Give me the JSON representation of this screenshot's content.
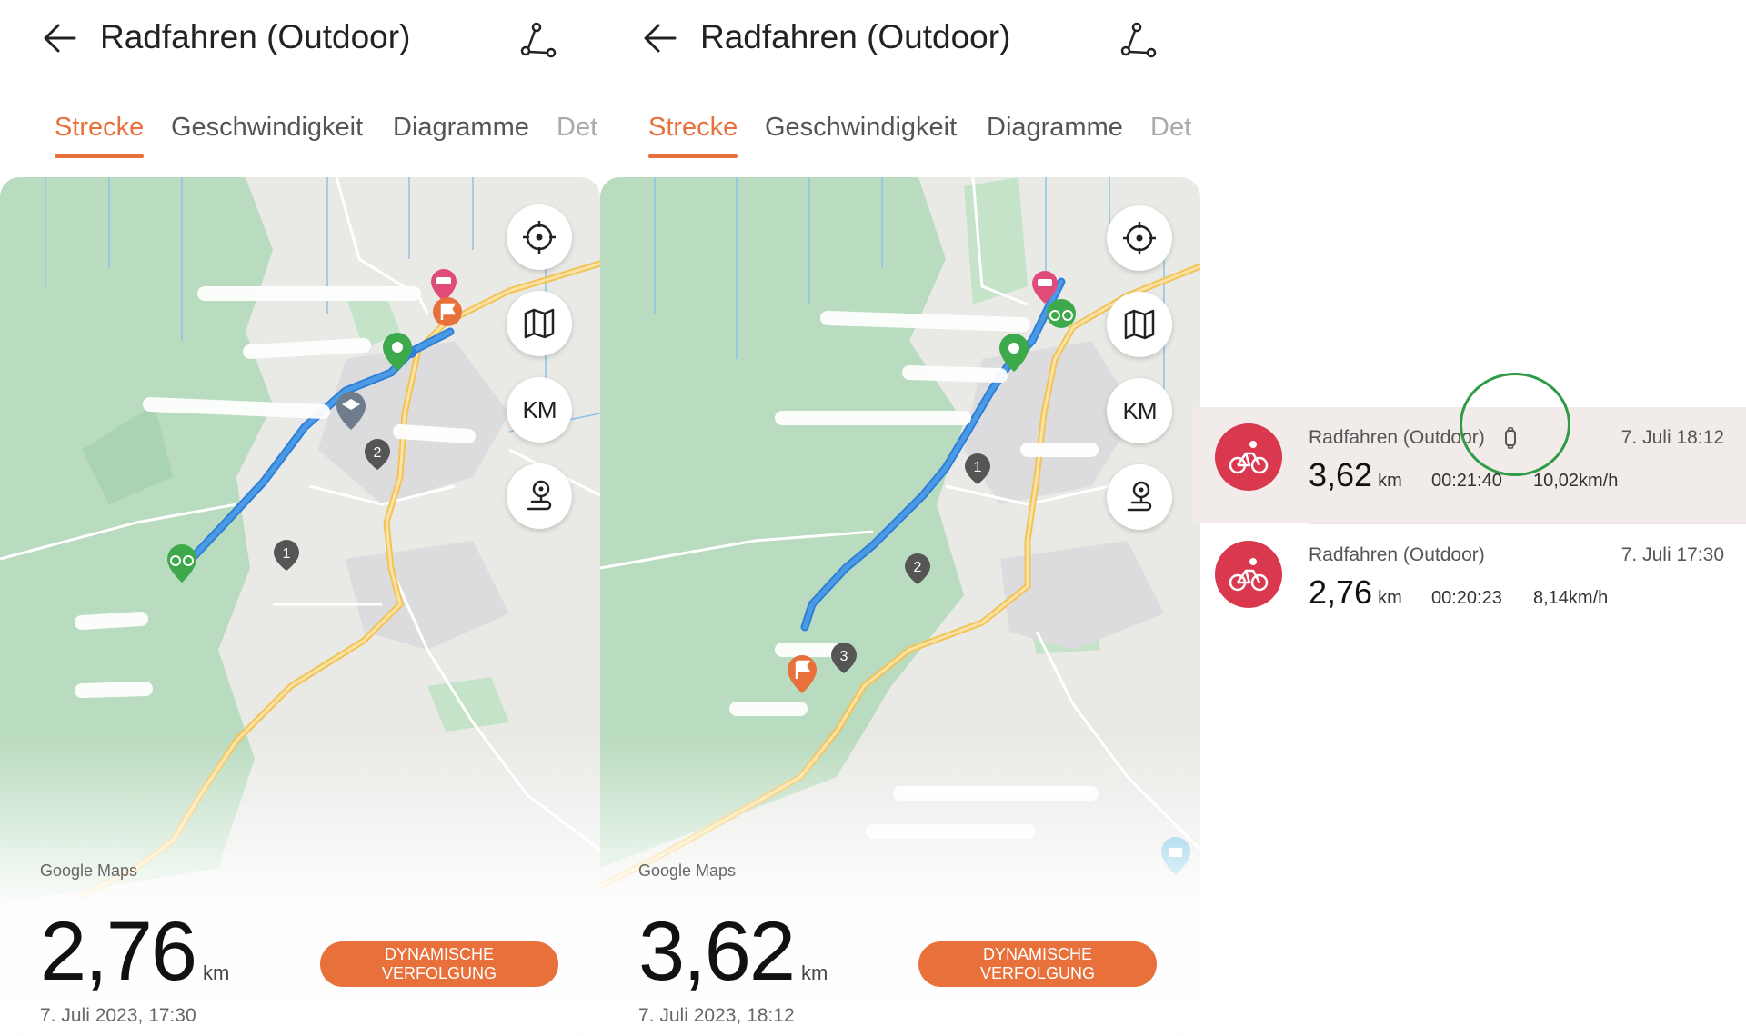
{
  "panels": [
    {
      "header": {
        "title": "Radfahren (Outdoor)"
      },
      "tabs": [
        "Strecke",
        "Geschwindigkeit",
        "Diagramme",
        "Det"
      ],
      "map": {
        "attribution": "Google Maps",
        "controls": [
          "locate-icon",
          "map-layers-icon",
          "KM",
          "route-pin-icon"
        ],
        "km_markers": [
          "1",
          "2"
        ]
      },
      "summary": {
        "distance": "2,76",
        "unit": "km",
        "datetime": "7. Juli 2023, 17:30",
        "button": "DYNAMISCHE VERFOLGUNG"
      }
    },
    {
      "header": {
        "title": "Radfahren (Outdoor)"
      },
      "tabs": [
        "Strecke",
        "Geschwindigkeit",
        "Diagramme",
        "Det"
      ],
      "map": {
        "attribution": "Google Maps",
        "controls": [
          "locate-icon",
          "map-layers-icon",
          "KM",
          "route-pin-icon"
        ],
        "km_markers": [
          "1",
          "2",
          "3"
        ]
      },
      "summary": {
        "distance": "3,62",
        "unit": "km",
        "datetime": "7. Juli 2023, 18:12",
        "button": "DYNAMISCHE VERFOLGUNG"
      }
    }
  ],
  "activities": [
    {
      "name": "Radfahren (Outdoor)",
      "date": "7. Juli 18:12",
      "distance": "3,62",
      "unit": "km",
      "duration": "00:21:40",
      "speed": "10,02km/h",
      "selected": true,
      "icon": "smartwatch-icon"
    },
    {
      "name": "Radfahren (Outdoor)",
      "date": "7. Juli 17:30",
      "distance": "2,76",
      "unit": "km",
      "duration": "00:20:23",
      "speed": "8,14km/h",
      "selected": false
    }
  ],
  "colors": {
    "accent": "#e8703a",
    "route": "#4a90d9",
    "activity_icon": "#d9384e",
    "highlight_circle": "#2f9b46"
  }
}
